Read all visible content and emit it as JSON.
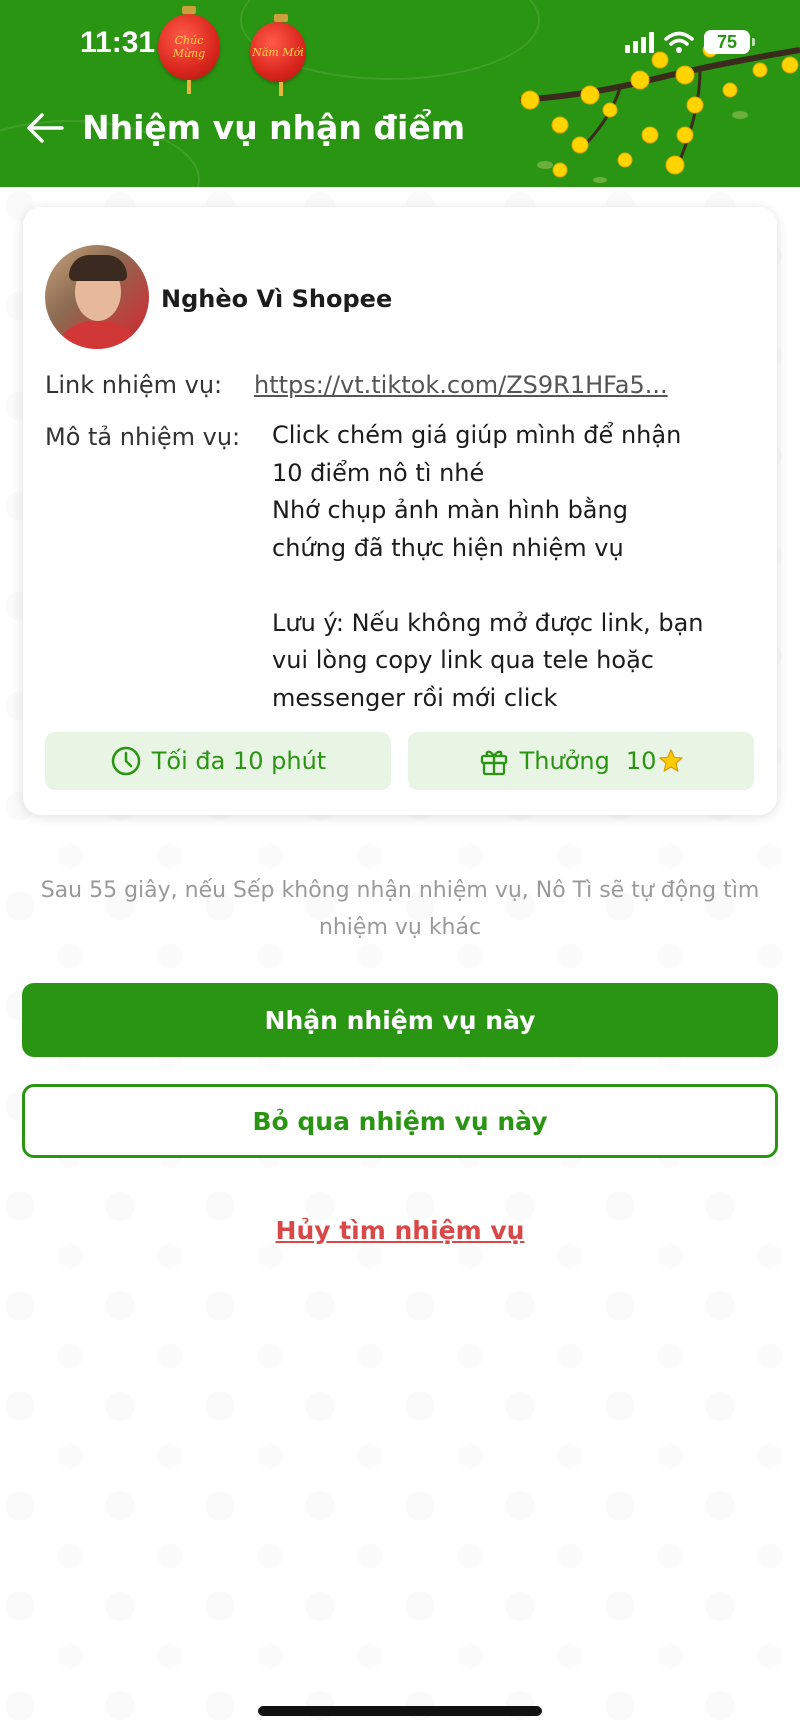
{
  "status_bar": {
    "time": "11:31",
    "battery": "75",
    "lantern_1_text": "Chúc Mừng",
    "lantern_2_text": "Năm Mới"
  },
  "header": {
    "title": "Nhiệm vụ nhận điểm"
  },
  "task": {
    "username": "Nghèo Vì Shopee",
    "link_label": "Link nhiệm vụ:",
    "link_value": "https://vt.tiktok.com/ZS9R1HFa5...",
    "desc_label": "Mô tả nhiệm vụ:",
    "desc_lines": [
      "Click chém giá giúp mình để nhận",
      "10 điểm nô tì nhé",
      "Nhớ chụp ảnh màn hình bằng",
      "chứng đã thực hiện nhiệm vụ",
      "",
      "Lưu ý: Nếu không mở được link, bạn",
      "vui lòng copy link qua tele hoặc",
      "messenger rồi mới click"
    ],
    "time_chip": "Tối đa 10 phút",
    "reward_chip_label": "Thưởng",
    "reward_chip_value": "10"
  },
  "notice": "Sau 55 giây, nếu Sếp không nhận nhiệm vụ, Nô Tì sẽ tự động tìm nhiệm vụ khác",
  "actions": {
    "accept": "Nhận nhiệm vụ này",
    "skip": "Bỏ qua nhiệm vụ này",
    "cancel": "Hủy tìm nhiệm vụ"
  },
  "colors": {
    "brand_green": "#2a9512",
    "cancel_red": "#d94848",
    "chip_bg": "#e8f5e4"
  }
}
